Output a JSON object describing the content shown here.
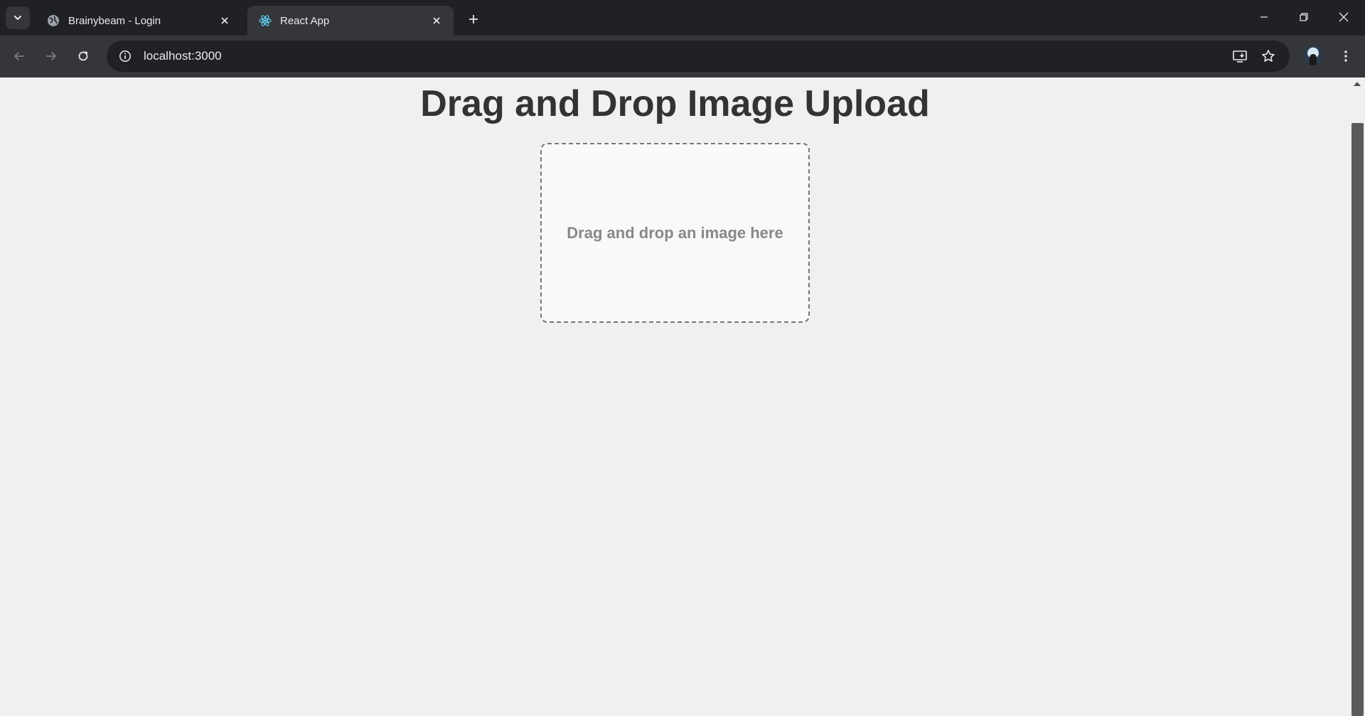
{
  "browser": {
    "tabs": [
      {
        "title": "Brainybeam - Login",
        "favicon": "globe-icon",
        "active": false
      },
      {
        "title": "React App",
        "favicon": "react-icon",
        "active": true
      }
    ],
    "address_bar": {
      "url": "localhost:3000"
    }
  },
  "page": {
    "title": "Drag and Drop Image Upload",
    "dropzone": {
      "text": "Drag and drop an image here"
    }
  },
  "colors": {
    "chrome_dark": "#202124",
    "chrome_toolbar": "#35363a",
    "page_background": "#f0f0f0",
    "title_text": "#333333",
    "dropzone_border": "#777777",
    "dropzone_text": "#888888"
  }
}
